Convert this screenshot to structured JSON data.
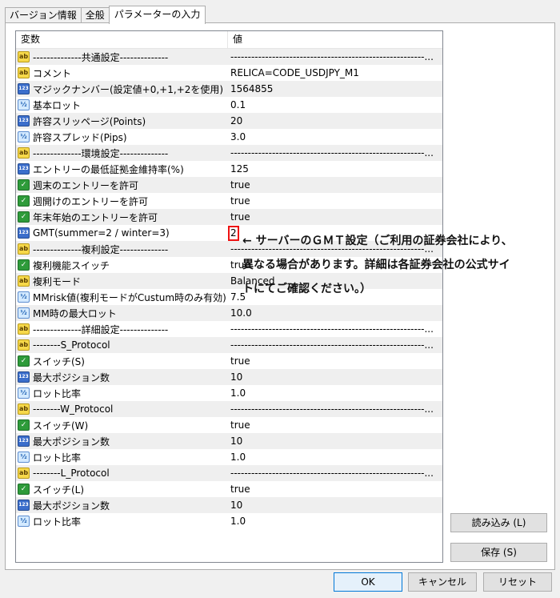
{
  "tabs": [
    "バージョン情報",
    "全般",
    "パラメーターの入力"
  ],
  "grid": {
    "header_var": "変数",
    "header_val": "値",
    "rows": [
      {
        "icon": "ab",
        "name": "--------------共通設定--------------",
        "value": "--------------------------------------------------------..."
      },
      {
        "icon": "ab",
        "name": "コメント",
        "value": "RELICA=CODE_USDJPY_M1"
      },
      {
        "icon": "123",
        "name": "マジックナンバー(設定値+0,+1,+2を使用)",
        "value": "1564855"
      },
      {
        "icon": "v2",
        "name": "基本ロット",
        "value": "0.1"
      },
      {
        "icon": "123",
        "name": "許容スリッページ(Points)",
        "value": "20"
      },
      {
        "icon": "v2",
        "name": "許容スプレッド(Pips)",
        "value": "3.0"
      },
      {
        "icon": "ab",
        "name": "--------------環境設定--------------",
        "value": "--------------------------------------------------------..."
      },
      {
        "icon": "123",
        "name": "エントリーの最低証拠金維持率(%)",
        "value": "125"
      },
      {
        "icon": "bool",
        "name": "週末のエントリーを許可",
        "value": "true"
      },
      {
        "icon": "bool",
        "name": "週開けのエントリーを許可",
        "value": "true"
      },
      {
        "icon": "bool",
        "name": "年末年始のエントリーを許可",
        "value": "true"
      },
      {
        "icon": "123",
        "name": "GMT(summer=2 / winter=3)",
        "value": "2"
      },
      {
        "icon": "ab",
        "name": "--------------複利設定--------------",
        "value": "--------------------------------------------------------..."
      },
      {
        "icon": "bool",
        "name": "複利機能スイッチ",
        "value": "true"
      },
      {
        "icon": "ab",
        "name": "複利モード",
        "value": "Balanced"
      },
      {
        "icon": "v2",
        "name": "MMrisk値(複利モードがCustum時のみ有効)",
        "value": "7.5"
      },
      {
        "icon": "v2",
        "name": "MM時の最大ロット",
        "value": "10.0"
      },
      {
        "icon": "ab",
        "name": "--------------詳細設定--------------",
        "value": "--------------------------------------------------------..."
      },
      {
        "icon": "ab",
        "name": "--------S_Protocol",
        "value": "--------------------------------------------------------..."
      },
      {
        "icon": "bool",
        "name": "スイッチ(S)",
        "value": "true"
      },
      {
        "icon": "123",
        "name": "最大ポジション数",
        "value": "10"
      },
      {
        "icon": "v2",
        "name": "ロット比率",
        "value": "1.0"
      },
      {
        "icon": "ab",
        "name": "--------W_Protocol",
        "value": "--------------------------------------------------------..."
      },
      {
        "icon": "bool",
        "name": "スイッチ(W)",
        "value": "true"
      },
      {
        "icon": "123",
        "name": "最大ポジション数",
        "value": "10"
      },
      {
        "icon": "v2",
        "name": "ロット比率",
        "value": "1.0"
      },
      {
        "icon": "ab",
        "name": "--------L_Protocol",
        "value": "--------------------------------------------------------..."
      },
      {
        "icon": "bool",
        "name": "スイッチ(L)",
        "value": "true"
      },
      {
        "icon": "123",
        "name": "最大ポジション数",
        "value": "10"
      },
      {
        "icon": "v2",
        "name": "ロット比率",
        "value": "1.0"
      }
    ]
  },
  "icon_labels": {
    "ab": "ab",
    "123": "123",
    "v2": "½",
    "bool": "✓"
  },
  "buttons": {
    "load": "読み込み (L)",
    "save": "保存 (S)",
    "ok": "OK",
    "cancel": "キャンセル",
    "reset": "リセット"
  },
  "annotation": {
    "line1": "← サーバーのＧＭＴ設定（ご利用の証券会社により、",
    "line2": "異なる場合があります。詳細は各証券会社の公式サイ",
    "line3": "トにてご確認ください。）"
  },
  "colors": {
    "highlight_box": "#ee1111",
    "row_alt": "#efefef"
  }
}
